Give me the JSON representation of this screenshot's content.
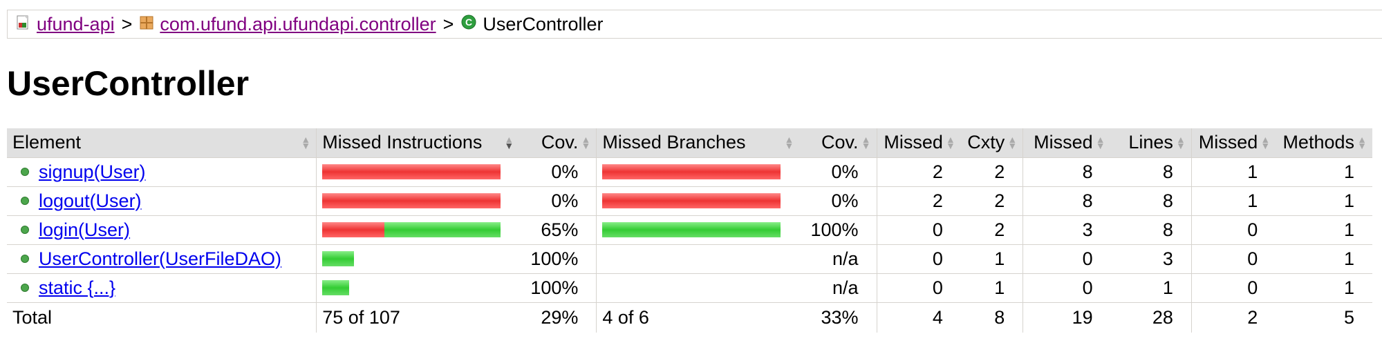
{
  "breadcrumb": {
    "project": "ufund-api",
    "package": "com.ufund.api.ufundapi.controller",
    "current": "UserController",
    "separator": ">"
  },
  "page_title": "UserController",
  "table": {
    "headers": [
      "Element",
      "Missed Instructions",
      "Cov.",
      "Missed Branches",
      "Cov.",
      "Missed",
      "Cxty",
      "Missed",
      "Lines",
      "Missed",
      "Methods"
    ],
    "rows": [
      {
        "element": "signup(User)",
        "instr_missed_fraction": 1.0,
        "instr_total_fraction": 1.0,
        "instr_cov": "0%",
        "branch_missed_fraction": 1.0,
        "branch_total_fraction": 1.0,
        "branch_cov": "0%",
        "cxty_missed": "2",
        "cxty": "2",
        "lines_missed": "8",
        "lines": "8",
        "methods_missed": "1",
        "methods": "1"
      },
      {
        "element": "logout(User)",
        "instr_missed_fraction": 1.0,
        "instr_total_fraction": 1.0,
        "instr_cov": "0%",
        "branch_missed_fraction": 1.0,
        "branch_total_fraction": 1.0,
        "branch_cov": "0%",
        "cxty_missed": "2",
        "cxty": "2",
        "lines_missed": "8",
        "lines": "8",
        "methods_missed": "1",
        "methods": "1"
      },
      {
        "element": "login(User)",
        "instr_missed_fraction": 0.35,
        "instr_total_fraction": 1.0,
        "instr_cov": "65%",
        "branch_missed_fraction": 0.0,
        "branch_total_fraction": 1.0,
        "branch_cov": "100%",
        "cxty_missed": "0",
        "cxty": "2",
        "lines_missed": "3",
        "lines": "8",
        "methods_missed": "0",
        "methods": "1"
      },
      {
        "element": "UserController(UserFileDAO)",
        "instr_missed_fraction": 0.0,
        "instr_total_fraction": 0.18,
        "instr_cov": "100%",
        "branch_missed_fraction": 0.0,
        "branch_total_fraction": 0.0,
        "branch_cov": "n/a",
        "cxty_missed": "0",
        "cxty": "1",
        "lines_missed": "0",
        "lines": "3",
        "methods_missed": "0",
        "methods": "1"
      },
      {
        "element": "static {...}",
        "instr_missed_fraction": 0.0,
        "instr_total_fraction": 0.15,
        "instr_cov": "100%",
        "branch_missed_fraction": 0.0,
        "branch_total_fraction": 0.0,
        "branch_cov": "n/a",
        "cxty_missed": "0",
        "cxty": "1",
        "lines_missed": "0",
        "lines": "1",
        "methods_missed": "0",
        "methods": "1"
      }
    ],
    "total": {
      "label": "Total",
      "instr": "75 of 107",
      "instr_cov": "29%",
      "branch": "4 of 6",
      "branch_cov": "33%",
      "cxty_missed": "4",
      "cxty": "8",
      "lines_missed": "19",
      "lines": "28",
      "methods_missed": "2",
      "methods": "5"
    }
  }
}
